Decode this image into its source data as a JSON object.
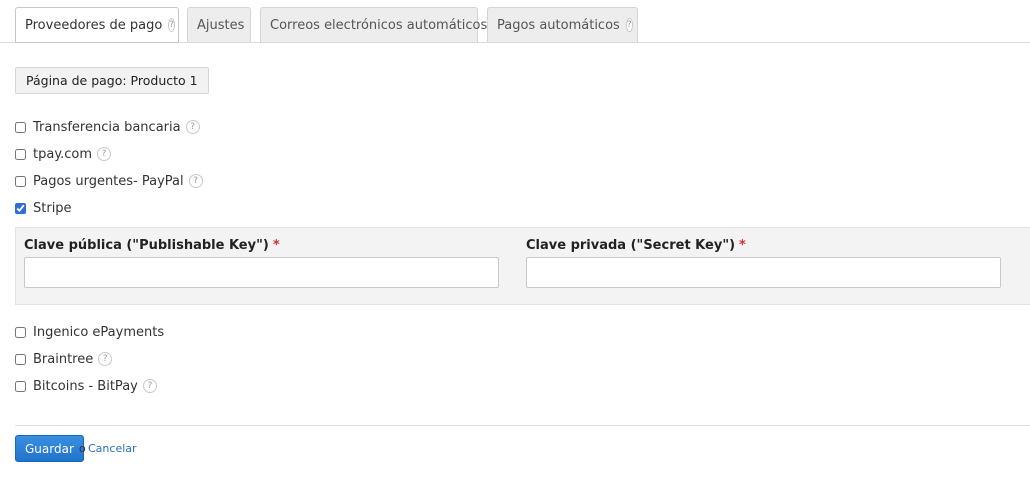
{
  "tabs": [
    {
      "label": "Proveedores de pago",
      "active": true,
      "help": "?"
    },
    {
      "label": "Ajustes",
      "active": false
    },
    {
      "label": "Correos electrónicos automáticos",
      "active": false
    },
    {
      "label": "Pagos automáticos",
      "active": false,
      "help": "?"
    }
  ],
  "page_selector": {
    "label": "Página de pago: Producto 1"
  },
  "providers": [
    {
      "label": "Transferencia bancaria",
      "checked": false,
      "help": "?"
    },
    {
      "label": "tpay.com",
      "checked": false,
      "help": "?"
    },
    {
      "label": "Pagos urgentes- PayPal",
      "checked": false,
      "help": "?"
    },
    {
      "label": "Stripe",
      "checked": true
    },
    {
      "label": "Ingenico ePayments",
      "checked": false
    },
    {
      "label": "Braintree",
      "checked": false,
      "help": "?"
    },
    {
      "label": "Bitcoins - BitPay",
      "checked": false,
      "help": "?"
    }
  ],
  "stripe": {
    "public_key_label": "Clave pública (\"Publishable Key\")",
    "public_key_value": "",
    "secret_key_label": "Clave privada (\"Secret Key\")",
    "secret_key_value": "",
    "required_mark": "*"
  },
  "actions": {
    "save_label": "Guardar",
    "or_text": "o",
    "cancel_label": "Cancelar"
  },
  "colors": {
    "accent": "#2a6fc4",
    "save_button": "#2b82d9",
    "required": "#d33131"
  }
}
